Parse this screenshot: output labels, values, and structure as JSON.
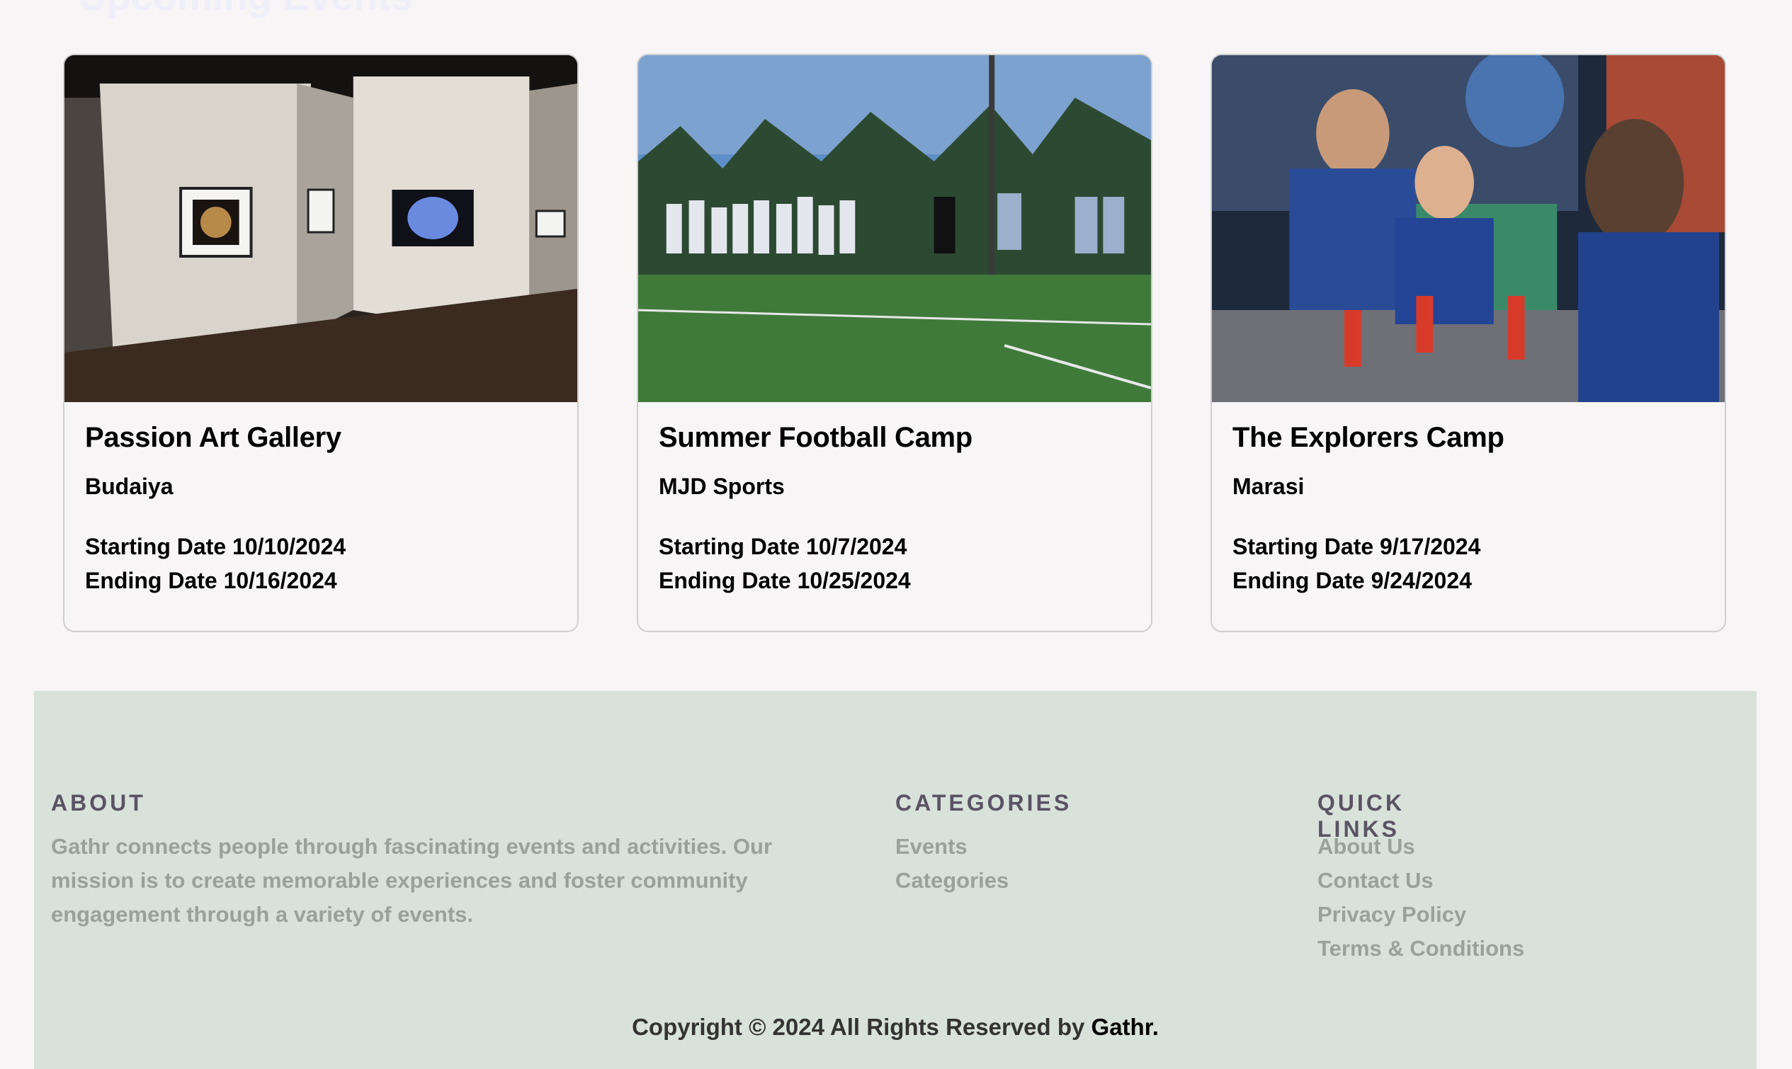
{
  "section": {
    "heading": "Upcoming Events"
  },
  "events": [
    {
      "title": "Passion Art Gallery",
      "venue": "Budaiya",
      "start": "Starting Date 10/10/2024",
      "end": "Ending Date 10/16/2024"
    },
    {
      "title": "Summer Football Camp",
      "venue": "MJD Sports",
      "start": "Starting Date 10/7/2024",
      "end": "Ending Date 10/25/2024"
    },
    {
      "title": "The Explorers Camp",
      "venue": "Marasi",
      "start": "Starting Date 9/17/2024",
      "end": "Ending Date 9/24/2024"
    }
  ],
  "footer": {
    "about": {
      "title": "ABOUT",
      "text": "Gathr connects people through fascinating events and activities. Our mission is to create memorable experiences and foster community engagement through a variety of events."
    },
    "categories": {
      "title": "CATEGORIES",
      "links": [
        "Events",
        "Categories"
      ]
    },
    "quick_links": {
      "title": "QUICK LINKS",
      "links": [
        "About Us",
        "Contact Us",
        "Privacy Policy",
        "Terms & Conditions"
      ]
    },
    "copyright": {
      "prefix": "Copyright © 2024 All Rights Reserved by ",
      "brand": "Gathr."
    }
  },
  "colors": {
    "footer_bg": "#d8e2da",
    "footer_title": "#5a5363",
    "footer_text": "#9aa19b"
  }
}
